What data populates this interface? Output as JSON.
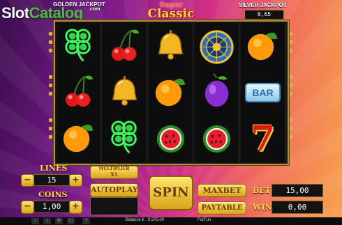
{
  "watermark": {
    "slot": "Slot",
    "catalog": "Catalog"
  },
  "jackpots": {
    "golden_label": "GOLDEN JACKPOT",
    "golden_sub": ".com",
    "silver_label": "SILVER JACKPOT",
    "silver_value": "0,65"
  },
  "logo": {
    "line1": "Super",
    "line2": "Classic"
  },
  "reels": [
    [
      "clover",
      "cherries",
      "orange"
    ],
    [
      "cherries",
      "bell",
      "clover"
    ],
    [
      "bell",
      "orange",
      "watermelon"
    ],
    [
      "wheel",
      "plum",
      "watermelon"
    ],
    [
      "orange",
      "bar",
      "seven"
    ]
  ],
  "symbols": {
    "bar": "BAR",
    "seven": "7"
  },
  "controls": {
    "lines_label": "LINES",
    "lines_value": "15",
    "coins_label": "COINS",
    "coins_value": "1,00",
    "minus": "−",
    "plus": "+",
    "multiplier_label": "MULTIPLIER",
    "multiplier_value": "X1",
    "autoplay": "AUTOPLAY",
    "spin": "SPIN",
    "maxbet": "MAXBET",
    "paytable": "PAYTABLE",
    "bet_label": "BET",
    "bet_value": "15,00",
    "win_label": "WIN",
    "win_value": "0,00"
  },
  "status": {
    "balance": "Balance € : 9.975,00",
    "provider": "ForFun"
  },
  "colors": {
    "accent": "#ffd33a",
    "frame": "#b68f38",
    "background_left": "#3b0d4e",
    "background_right": "#f7a24c"
  }
}
